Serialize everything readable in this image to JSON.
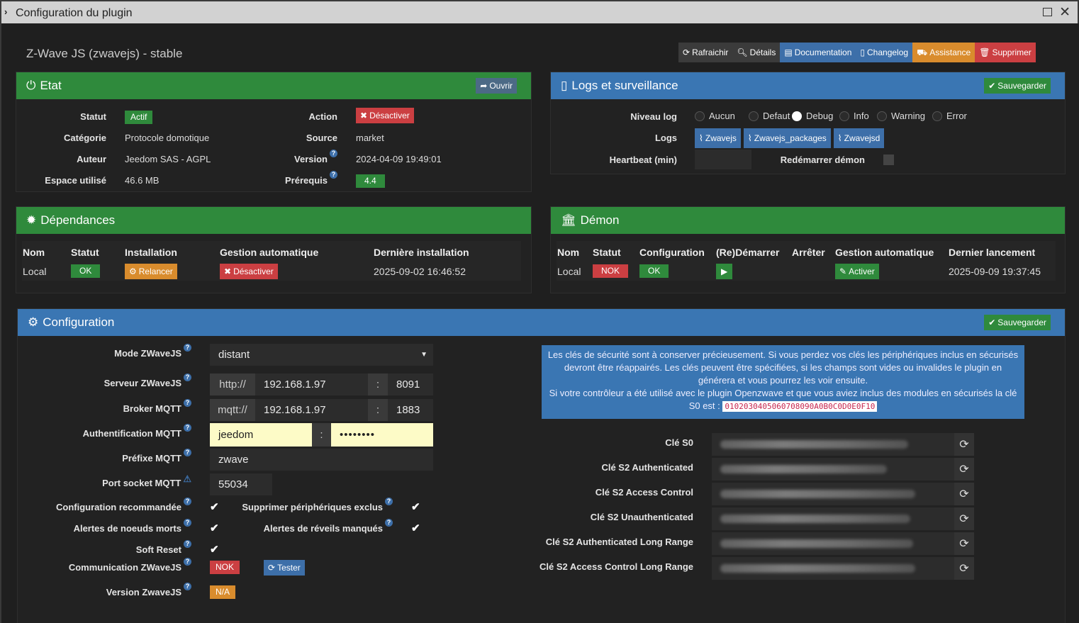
{
  "window": {
    "title": "Configuration du plugin"
  },
  "plugin": {
    "title": "Z-Wave JS (zwavejs) - stable"
  },
  "toolbar": {
    "refresh": "Rafraichir",
    "details": "Détails",
    "documentation": "Documentation",
    "changelog": "Changelog",
    "assistance": "Assistance",
    "delete": "Supprimer"
  },
  "etat": {
    "title": "Etat",
    "open": "Ouvrir",
    "statut_label": "Statut",
    "statut_value": "Actif",
    "categorie_label": "Catégorie",
    "categorie_value": "Protocole domotique",
    "auteur_label": "Auteur",
    "auteur_value": "Jeedom SAS - AGPL",
    "espace_label": "Espace utilisé",
    "espace_value": "46.6 MB",
    "action_label": "Action",
    "action_value": "Désactiver",
    "source_label": "Source",
    "source_value": "market",
    "version_label": "Version",
    "version_value": "2024-04-09 19:49:01",
    "prerequis_label": "Prérequis",
    "prerequis_value": "4.4"
  },
  "logs": {
    "title": "Logs et surveillance",
    "save": "Sauvegarder",
    "niveau_label": "Niveau log",
    "levels": [
      "Aucun",
      "Defaut",
      "Debug",
      "Info",
      "Warning",
      "Error"
    ],
    "selected": "Debug",
    "logs_label": "Logs",
    "log_buttons": [
      "Zwavejs",
      "Zwavejs_packages",
      "Zwavejsd"
    ],
    "heartbeat_label": "Heartbeat (min)",
    "restart_label": "Redémarrer démon"
  },
  "deps": {
    "title": "Dépendances",
    "headers": {
      "nom": "Nom",
      "statut": "Statut",
      "installation": "Installation",
      "gestion": "Gestion automatique",
      "derniere": "Dernière installation"
    },
    "row": {
      "nom": "Local",
      "statut": "OK",
      "installation": "Relancer",
      "gestion": "Désactiver",
      "derniere": "2025-09-02 16:46:52"
    }
  },
  "demon": {
    "title": "Démon",
    "headers": {
      "nom": "Nom",
      "statut": "Statut",
      "configuration": "Configuration",
      "redemarrer": "(Re)Démarrer",
      "arreter": "Arrêter",
      "gestion": "Gestion automatique",
      "dernier": "Dernier lancement"
    },
    "row": {
      "nom": "Local",
      "statut": "NOK",
      "configuration": "OK",
      "gestion": "Activer",
      "dernier": "2025-09-09 19:37:45"
    }
  },
  "config": {
    "title": "Configuration",
    "save": "Sauvegarder",
    "mode_label": "Mode ZWaveJS",
    "mode_value": "distant",
    "serveur_label": "Serveur ZWaveJS",
    "serveur_proto": "http://",
    "serveur_ip": "192.168.1.97",
    "serveur_port": "8091",
    "broker_label": "Broker MQTT",
    "broker_proto": "mqtt://",
    "broker_ip": "192.168.1.97",
    "broker_port": "1883",
    "auth_label": "Authentification MQTT",
    "auth_user": "jeedom",
    "auth_pass": "••••••••",
    "prefix_label": "Préfixe MQTT",
    "prefix_value": "zwave",
    "port_label": "Port socket MQTT",
    "port_value": "55034",
    "reco_label": "Configuration recommandée",
    "suppr_label": "Supprimer périphériques exclus",
    "alert_noeuds_label": "Alertes de noeuds morts",
    "alert_reveils_label": "Alertes de réveils manqués",
    "soft_label": "Soft Reset",
    "comm_label": "Communication ZWaveJS",
    "comm_value": "NOK",
    "tester": "Tester",
    "version_label": "Version ZwaveJS",
    "version_value": "N/A",
    "info_text": "Les clés de sécurité sont à conserver précieusement. Si vous perdez vos clés les périphériques inclus en sécurisés devront être réappairés. Les clés peuvent être spécifiées, si les champs sont vides ou invalides le plugin en générera et vous pourrez les voir ensuite.",
    "info_text2": "Si votre contrôleur a été utilisé avec le plugin Openzwave et que vous aviez inclus des modules en sécurisés la clé S0 est :",
    "info_code": "0102030405060708090A0B0C0D0E0F10",
    "keys": [
      "Clé S0",
      "Clé S2 Authenticated",
      "Clé S2 Access Control",
      "Clé S2 Unauthenticated",
      "Clé S2 Authenticated Long Range",
      "Clé S2 Access Control Long Range"
    ]
  },
  "colors": {
    "green": "#2f8a3c",
    "blue": "#3a76b3",
    "red": "#cb3f42",
    "orange": "#d98c2d"
  }
}
